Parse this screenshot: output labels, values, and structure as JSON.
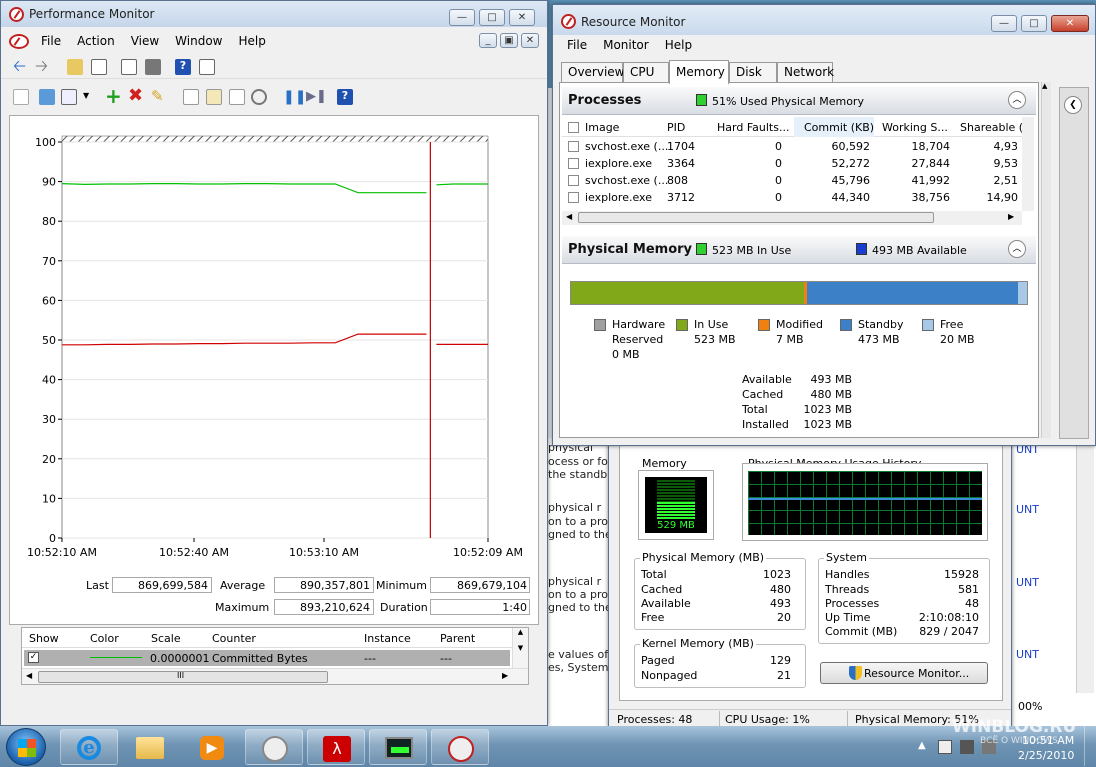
{
  "perfmon": {
    "title": "Performance Monitor",
    "menu": [
      "File",
      "Action",
      "View",
      "Window",
      "Help"
    ],
    "chart_data": {
      "type": "line",
      "ylim": [
        0,
        100
      ],
      "yticks": [
        0,
        10,
        20,
        30,
        40,
        50,
        60,
        70,
        80,
        90,
        100
      ],
      "xticks": [
        "10:52:10 AM",
        "10:52:40 AM",
        "10:53:10 AM",
        "10:52:09 AM"
      ],
      "series": [
        {
          "color": "#00c000",
          "values": [
            89.5,
            89.3,
            89.4,
            89.4,
            89.5,
            89.5,
            89.4,
            89.4,
            89.5,
            89.5,
            89.4,
            89.4,
            89.4,
            87.2,
            87.2,
            87.2,
            87.2,
            89.2,
            89.4,
            89.4,
            89.4
          ]
        },
        {
          "color": "#d00000",
          "values": [
            48.8,
            48.8,
            48.9,
            48.9,
            49.0,
            49.0,
            49.1,
            49.1,
            49.2,
            49.2,
            49.2,
            49.3,
            49.3,
            51.5,
            51.5,
            51.5,
            51.5,
            48.9,
            48.9,
            48.9,
            48.9
          ]
        }
      ]
    },
    "stats": {
      "last_label": "Last",
      "last": "869,699,584",
      "avg_label": "Average",
      "avg": "890,357,801",
      "min_label": "Minimum",
      "min": "869,679,104",
      "max_label": "Maximum",
      "max": "893,210,624",
      "dur_label": "Duration",
      "dur": "1:40"
    },
    "legend_headers": [
      "Show",
      "Color",
      "Scale",
      "Counter",
      "Instance",
      "Parent"
    ],
    "legend_row": {
      "scale": "0.0000001",
      "counter": "Committed Bytes",
      "instance": "---",
      "parent": "---"
    },
    "hscroll_label": "III"
  },
  "resmon": {
    "title": "Resource Monitor",
    "menu": [
      "File",
      "Monitor",
      "Help"
    ],
    "tabs": [
      "Overview",
      "CPU",
      "Memory",
      "Disk",
      "Network"
    ],
    "processes": {
      "title": "Processes",
      "status": "51% Used Physical Memory",
      "headers": [
        "Image",
        "PID",
        "Hard Faults...",
        "Commit (KB)",
        "Working S...",
        "Shareable (..."
      ],
      "rows": [
        [
          "svchost.exe (...",
          "1704",
          "0",
          "60,592",
          "18,704",
          "4,93"
        ],
        [
          "iexplore.exe",
          "3364",
          "0",
          "52,272",
          "27,844",
          "9,53"
        ],
        [
          "svchost.exe (...",
          "808",
          "0",
          "45,796",
          "41,992",
          "2,51"
        ],
        [
          "iexplore.exe",
          "3712",
          "0",
          "44,340",
          "38,756",
          "14,90"
        ]
      ]
    },
    "physical": {
      "title": "Physical Memory",
      "in_use": "523 MB In Use",
      "available": "493 MB Available",
      "bar": {
        "hardware": 0,
        "in_use": 523,
        "modified": 7,
        "standby": 473,
        "free": 20
      },
      "legend": [
        {
          "name": "Hardware Reserved",
          "l1": "Hardware",
          "l2": "Reserved",
          "val": "0 MB",
          "color": "#a0a0a0"
        },
        {
          "name": "In Use",
          "l1": "In Use",
          "l2": "",
          "val": "523 MB",
          "color": "#80a818"
        },
        {
          "name": "Modified",
          "l1": "Modified",
          "l2": "",
          "val": "7 MB",
          "color": "#f08010"
        },
        {
          "name": "Standby",
          "l1": "Standby",
          "l2": "",
          "val": "473 MB",
          "color": "#3c80c8"
        },
        {
          "name": "Free",
          "l1": "Free",
          "l2": "",
          "val": "20 MB",
          "color": "#a8c8e8"
        }
      ],
      "summary": [
        {
          "k": "Available",
          "v": "493 MB"
        },
        {
          "k": "Cached",
          "v": "480 MB"
        },
        {
          "k": "Total",
          "v": "1023 MB"
        },
        {
          "k": "Installed",
          "v": "1023 MB"
        }
      ]
    }
  },
  "taskmgr": {
    "memory_label": "Memory",
    "meter_value": "529 MB",
    "history_label": "Physical Memory Usage History",
    "pm_title": "Physical Memory (MB)",
    "pm": [
      {
        "k": "Total",
        "v": "1023"
      },
      {
        "k": "Cached",
        "v": "480"
      },
      {
        "k": "Available",
        "v": "493"
      },
      {
        "k": "Free",
        "v": "20"
      }
    ],
    "km_title": "Kernel Memory (MB)",
    "km": [
      {
        "k": "Paged",
        "v": "129"
      },
      {
        "k": "Nonpaged",
        "v": "21"
      }
    ],
    "sys_title": "System",
    "sys": [
      {
        "k": "Handles",
        "v": "15928"
      },
      {
        "k": "Threads",
        "v": "581"
      },
      {
        "k": "Processes",
        "v": "48"
      },
      {
        "k": "Up Time",
        "v": "2:10:08:10"
      },
      {
        "k": "Commit (MB)",
        "v": "829 / 2047"
      }
    ],
    "resmon_button": "Resource Monitor...",
    "status": {
      "processes": "Processes: 48",
      "cpu": "CPU Usage: 1%",
      "physical": "Physical Memory: 51%"
    }
  },
  "background": {
    "text": [
      "physical",
      "ocess or fo",
      "the standb",
      "physical r",
      "on to a pro",
      "gned to the",
      "physical r",
      "on to a pro",
      "gned to the",
      "e values of",
      "es, System"
    ],
    "unt": "UNT",
    "zoom": "00%"
  },
  "taskbar": {
    "time": "10:51 AM",
    "date": "2/25/2010",
    "watermark": "WINBLOG.RU",
    "watermark_sub": "ВСЁ О WINDOWS"
  }
}
